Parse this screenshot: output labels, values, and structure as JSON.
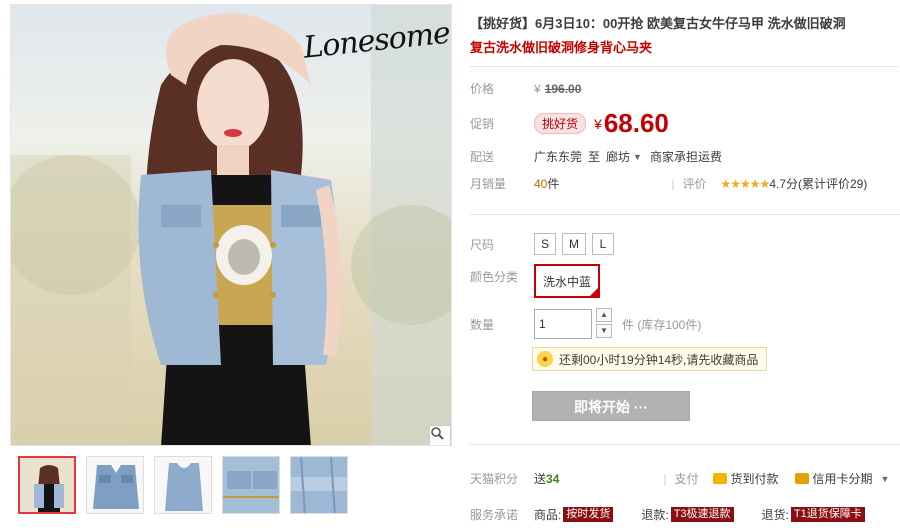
{
  "product": {
    "title": "【挑好货】6月3日10：00开抢 欧美复古女牛仔马甲 洗水做旧破洞",
    "subtitle": "复古洗水做旧破洞修身背心马夹",
    "brand_logo": "Lonesome town"
  },
  "price": {
    "label": "价格",
    "currency": "¥",
    "original": "196.00"
  },
  "promo": {
    "label": "促销",
    "tag": "挑好货",
    "currency": "¥",
    "price": "68.60"
  },
  "delivery": {
    "label": "配送",
    "from": "广东东莞",
    "to_word": "至",
    "destination": "廊坊",
    "courier": "商家承担运费"
  },
  "sales": {
    "label": "月销量",
    "count": "40",
    "unit": "件",
    "rating_label": "评价",
    "stars": "★★★★★",
    "score": "4.7分",
    "cumulative": "(累计评价29)"
  },
  "size": {
    "label": "尺码",
    "options": [
      "S",
      "M",
      "L"
    ]
  },
  "color": {
    "label": "颜色分类",
    "selected": "洗水中蓝"
  },
  "quantity": {
    "label": "数量",
    "value": "1",
    "unit_stock": "件 (库存100件)"
  },
  "countdown": {
    "text": "还剩00小时19分钟14秒,请先收藏商品"
  },
  "buy_button": "即将开始 ···",
  "points": {
    "label": "天猫积分",
    "prefix": "送",
    "value": "34"
  },
  "payment": {
    "label": "支付",
    "cod": "货到付款",
    "installment": "信用卡分期"
  },
  "service": {
    "label": "服务承诺",
    "item1_prefix": "商品:",
    "item1_tag": "按时发货",
    "item2_prefix": "退款:",
    "item2_tag": "T3极速退款",
    "item3_prefix": "退货:",
    "item3_tag": "T1退货保障卡"
  },
  "colors": {
    "accent_red": "#c40000",
    "star_orange": "#f5a623",
    "buy_button_gray": "#b2b2b2",
    "service_tag": "#8b0e12"
  }
}
